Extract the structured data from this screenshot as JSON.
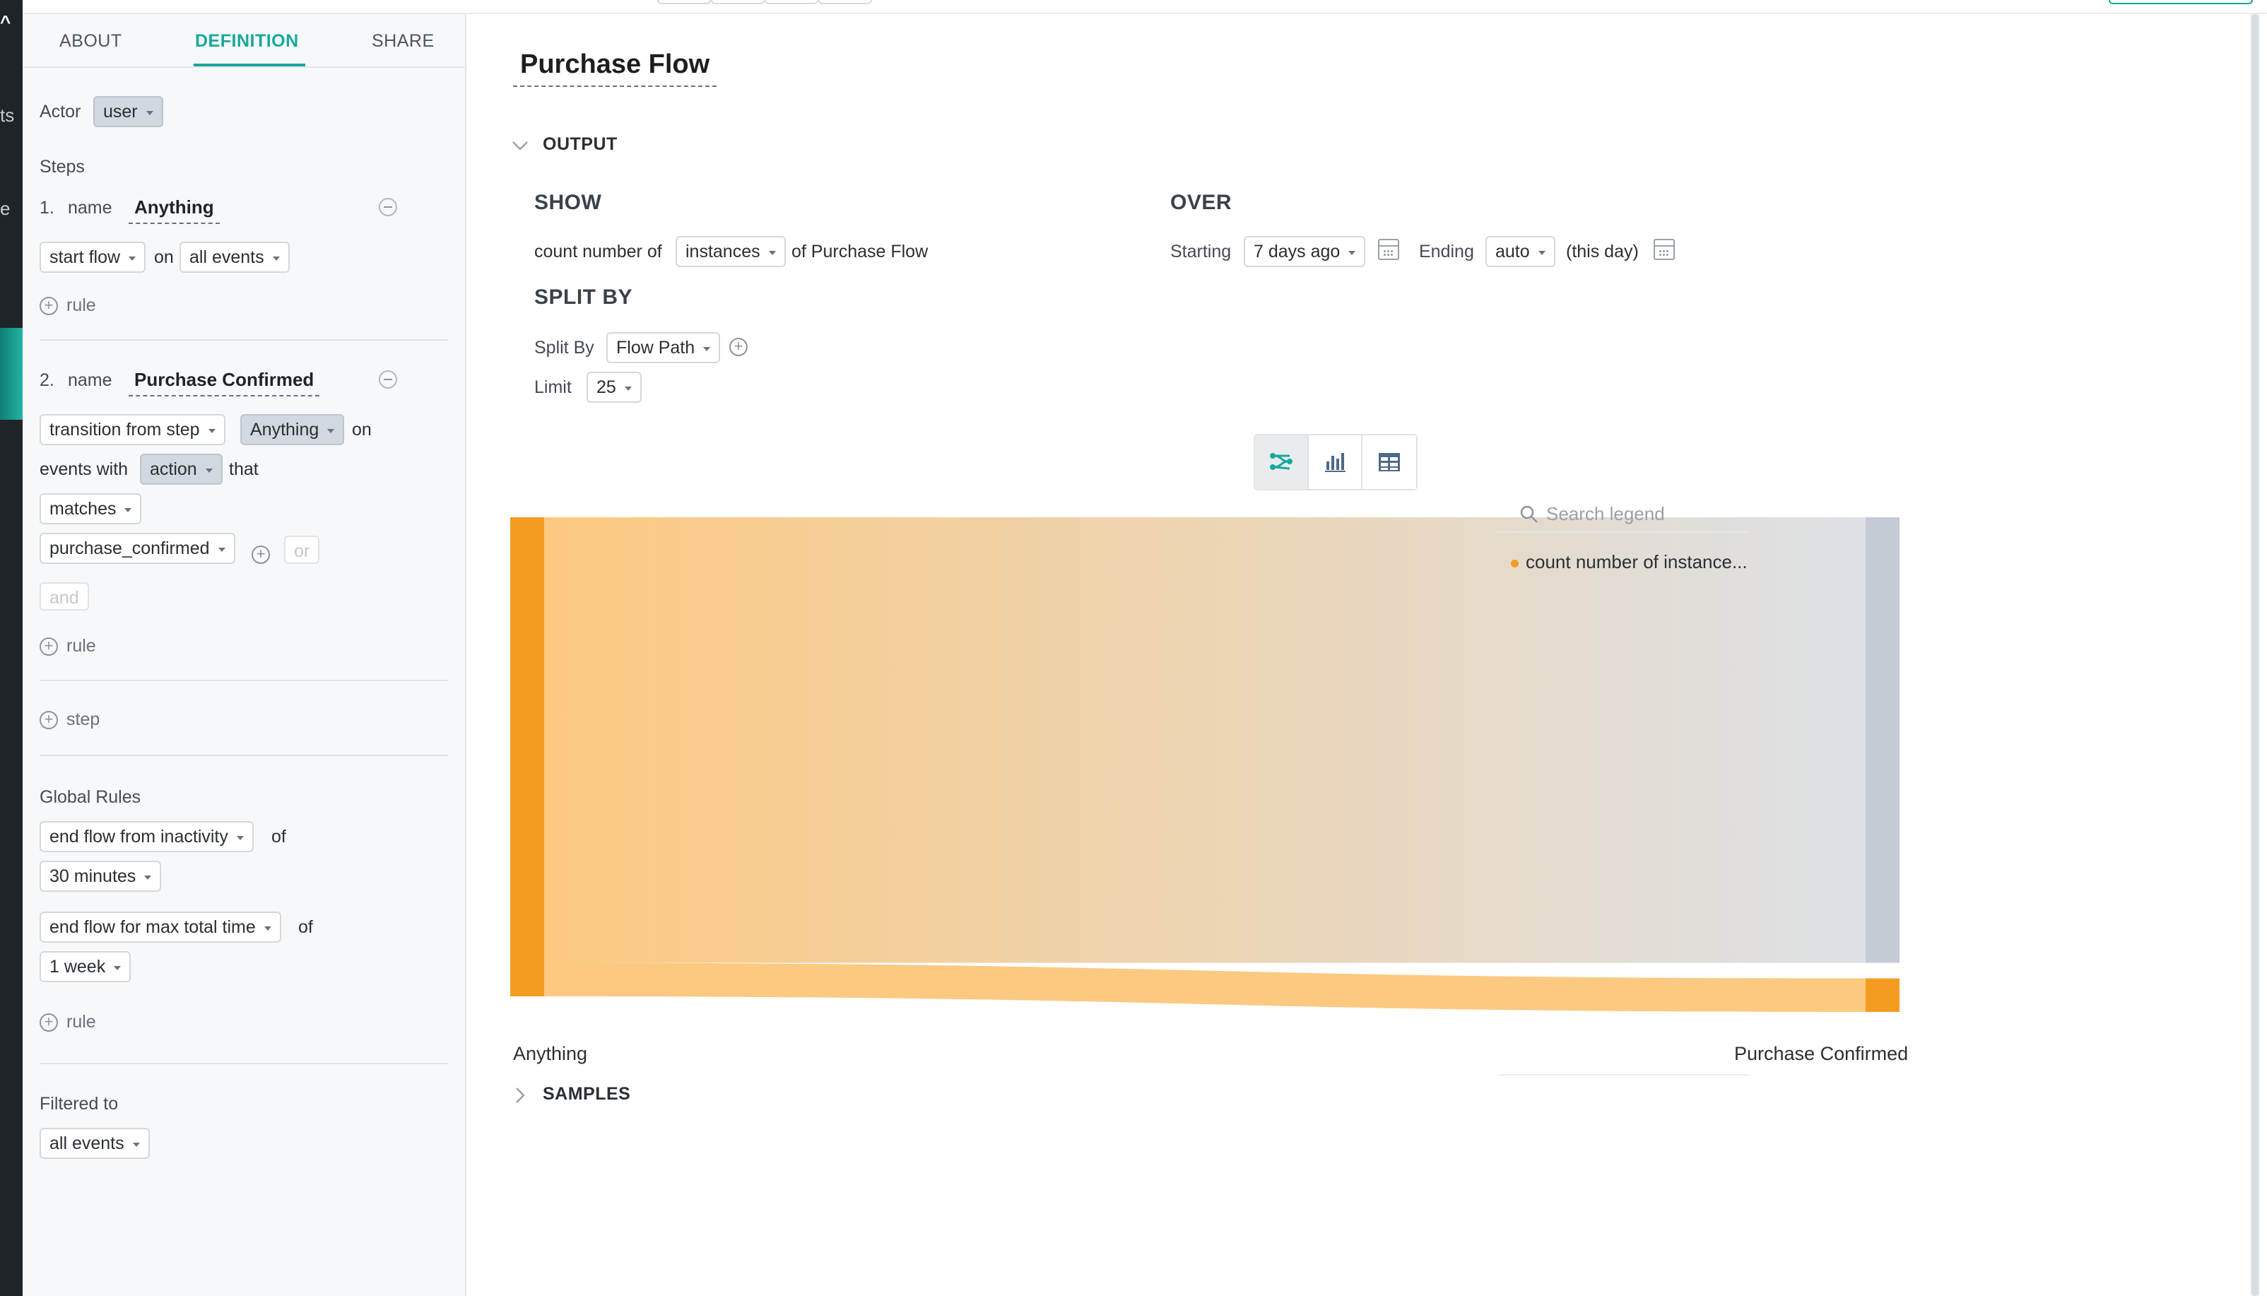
{
  "colors": {
    "accent": "#17a89a",
    "sankey_source": "#f39c21",
    "sankey_target_gray": "#c5cbd4",
    "sankey_flow_light": "#fcc981"
  },
  "rail": {
    "chars": [
      "ts",
      "e"
    ]
  },
  "tabs": [
    {
      "label": "ABOUT",
      "active": false
    },
    {
      "label": "DEFINITION",
      "active": true
    },
    {
      "label": "SHARE",
      "active": false
    }
  ],
  "definition": {
    "actor_label": "Actor",
    "actor_value": "user",
    "steps_label": "Steps",
    "step1": {
      "number": "1.",
      "name_label": "name",
      "name_value": "Anything",
      "flow_type": "start flow",
      "on_label": "on",
      "events": "all events",
      "add_rule": "rule"
    },
    "step2": {
      "number": "2.",
      "name_label": "name",
      "name_value": "Purchase Confirmed",
      "transition": "transition from step",
      "from_step": "Anything",
      "on_label": "on",
      "events_with_label": "events with",
      "field": "action",
      "that_label": "that",
      "operator": "matches",
      "value": "purchase_confirmed",
      "or_label": "or",
      "and_label": "and",
      "add_rule": "rule"
    },
    "add_step": "step",
    "global_rules_label": "Global Rules",
    "rule1": {
      "type": "end flow from inactivity",
      "of_label": "of",
      "duration": "30 minutes"
    },
    "rule2": {
      "type": "end flow for max total time",
      "of_label": "of",
      "duration": "1 week"
    },
    "add_global_rule": "rule",
    "filtered_to_label": "Filtered to",
    "filtered_to_value": "all events"
  },
  "main": {
    "title": "Purchase Flow",
    "output_label": "OUTPUT",
    "show": {
      "heading": "SHOW",
      "prefix": "count number of",
      "metric": "instances",
      "suffix": "of Purchase Flow"
    },
    "over": {
      "heading": "OVER",
      "starting_label": "Starting",
      "starting_value": "7 days ago",
      "ending_label": "Ending",
      "ending_value": "auto",
      "ending_note": "(this day)"
    },
    "split": {
      "heading": "SPLIT BY",
      "split_label": "Split By",
      "split_value": "Flow Path",
      "limit_label": "Limit",
      "limit_value": "25"
    },
    "viz_icons": [
      "sankey-icon",
      "bar-chart-icon",
      "table-icon"
    ],
    "samples_label": "SAMPLES"
  },
  "chart_data": {
    "type": "sankey",
    "nodes": [
      "Anything",
      "Purchase Confirmed"
    ],
    "flows": [
      {
        "from": "Anything",
        "to": "Anything",
        "value": 93
      },
      {
        "from": "Anything",
        "to": "Purchase Confirmed",
        "value": 7
      }
    ]
  },
  "legend": {
    "search_placeholder": "Search legend",
    "items": [
      "count number of instance..."
    ]
  }
}
